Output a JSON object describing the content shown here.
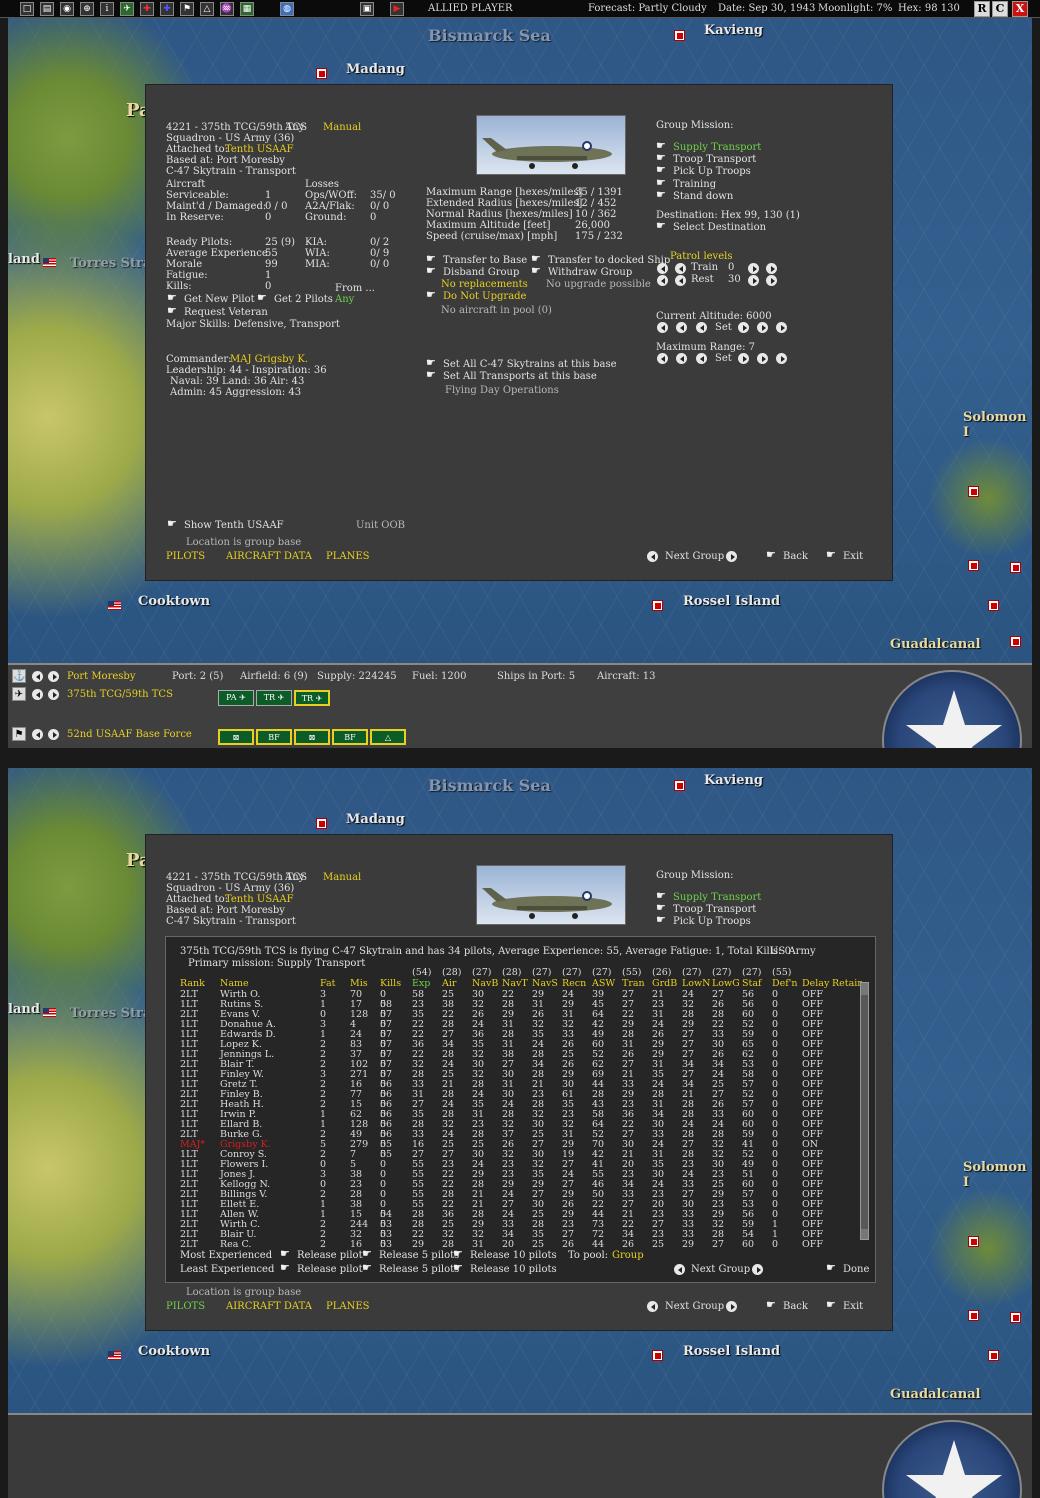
{
  "toolbar": {
    "icons": [
      "□",
      "▤",
      "◉",
      "⊕",
      "i",
      "✈",
      "✚",
      "✚",
      "⚑",
      "△",
      "♒",
      "▦",
      "◍",
      "▣",
      "▶"
    ],
    "player": "ALLIED PLAYER",
    "forecast": "Forecast: Partly Cloudy",
    "date": "Date: Sep 30, 1943",
    "moonlight": "Moonlight: 7%",
    "hex": "Hex: 98 130",
    "btn_r": "R",
    "btn_c": "C",
    "btn_x": "X"
  },
  "map": {
    "bismarck": "Bismarck Sea",
    "kavieng": "Kavieng",
    "madang": "Madang",
    "pa": "Pa",
    "torres": "Torres Stra",
    "land": "land",
    "solomon": "Solomon I",
    "cooktown": "Cooktown",
    "rossel": "Rossel Island",
    "guadalcanal": "Guadalcanal"
  },
  "group": {
    "title": "4221 - 375th TCG/59th TCS",
    "any": "Any",
    "manual": "Manual",
    "squadron": "Squadron - US Army (36)",
    "attached_label": "Attached to:",
    "attached": "Tenth USAAF",
    "based": "Based at: Port Moresby",
    "aircraft_type": "C-47 Skytrain - Transport",
    "aircraft_hdr": "Aircraft",
    "losses_hdr": "Losses",
    "serviceable_l": "Serviceable:",
    "serviceable_v": "1",
    "maintd_l": "Maint'd / Damaged:",
    "maintd_v": "0 / 0",
    "reserve_l": "In Reserve:",
    "reserve_v": "0",
    "ops_l": "Ops/WOff:",
    "ops_v": "35/ 0",
    "a2a_l": "A2A/Flak:",
    "a2a_v": "0/ 0",
    "ground_l": "Ground:",
    "ground_v": "0",
    "ready_l": "Ready Pilots:",
    "ready_v": "25 (9)",
    "avgexp_l": "Average Experience",
    "avgexp_v": "55",
    "morale_l": "Morale",
    "morale_v": "99",
    "fatigue_l": "Fatigue:",
    "fatigue_v": "1",
    "kills_l": "Kills:",
    "kills_v": "0",
    "kia_l": "KIA:",
    "kia_v": "0/ 2",
    "wia_l": "WIA:",
    "wia_v": "0/ 9",
    "mia_l": "MIA:",
    "mia_v": "0/ 0",
    "from_l": "From ...",
    "from_v": "Any",
    "get_new_pilot": "Get New Pilot",
    "get_2_pilots": "Get 2 Pilots",
    "request_veteran": "Request Veteran",
    "major_skills": "Major Skills: Defensive, Transport",
    "commander_l": "Commander:",
    "commander_v": "MAJ Grigsby K.",
    "leadership": "Leadership: 44 - Inspiration: 36",
    "naval_land_air": "Naval: 39  Land: 36  Air: 43",
    "admin_aggr": "Admin: 45  Aggression: 43",
    "max_range_l": "Maximum Range [hexes/miles]",
    "max_range_v": "35 / 1391",
    "ext_radius_l": "Extended Radius [hexes/miles]",
    "ext_radius_v": "12 / 452",
    "norm_radius_l": "Normal Radius [hexes/miles]",
    "norm_radius_v": "10 / 362",
    "max_alt_l": "Maximum Altitude [feet]",
    "max_alt_v": "26,000",
    "speed_l": "Speed (cruise/max) [mph]",
    "speed_v": "175 / 232",
    "transfer_base": "Transfer to Base",
    "transfer_ship": "Transfer to docked Ship",
    "disband": "Disband Group",
    "withdraw": "Withdraw Group",
    "no_replacements": "No replacements",
    "no_upgrade_possible": "No upgrade possible",
    "do_not_upgrade": "Do Not Upgrade",
    "no_aircraft_pool": "No aircraft in pool (0)",
    "set_all_c47": "Set All C-47 Skytrains at this base",
    "set_all_transports": "Set All Transports at this base",
    "flying_day": "Flying Day Operations",
    "show_tenth": "Show Tenth USAAF",
    "unit_oob": "Unit OOB",
    "location": "Location is group base",
    "tab_pilots": "PILOTS",
    "tab_aircraft": "AIRCRAFT DATA",
    "tab_planes": "PLANES",
    "next_group": "Next Group",
    "back": "Back",
    "exit": "Exit"
  },
  "mission": {
    "header": "Group Mission:",
    "supply": "Supply Transport",
    "troop": "Troop Transport",
    "pickup": "Pick Up Troops",
    "training": "Training",
    "standdown": "Stand down",
    "destination": "Destination: Hex 99, 130 (1)",
    "select_dest": "Select Destination",
    "patrol_levels": "Patrol levels",
    "train_l": "Train",
    "train_v": "0",
    "rest_l": "Rest",
    "rest_v": "30",
    "current_alt": "Current Altitude: 6000",
    "set": "Set",
    "max_range": "Maximum Range: 7"
  },
  "infobar": {
    "port_moresby": "Port Moresby",
    "port": "Port: 2 (5)",
    "airfield": "Airfield: 6 (9)",
    "supply": "Supply: 224245",
    "fuel": "Fuel: 1200",
    "ships": "Ships in Port: 5",
    "aircraft": "Aircraft: 13",
    "group_name": "375th TCG/59th TCS",
    "base_force": "52nd USAAF Base Force",
    "slots_air": [
      "PA",
      "TR",
      "TR"
    ],
    "slots_units": [
      "⊠",
      "BF",
      "⊠",
      "BF",
      "△"
    ]
  },
  "roster": {
    "summary": "375th TCG/59th TCS is flying C-47 Skytrain and has 34 pilots,  Average Experience: 55, Average Fatigue: 1, Total Kills: 0",
    "army": "US Army",
    "primary": "Primary mission: Supply Transport",
    "avg_row": [
      "(54)",
      "(28)",
      "(27)",
      "(28)",
      "(27)",
      "(27)",
      "(27)",
      "(55)",
      "(26)",
      "(27)",
      "(27)",
      "(27)",
      "(55)"
    ],
    "headers": [
      "Rank",
      "Name",
      "Fat",
      "Mis",
      "Kills",
      "Exp",
      "Air",
      "NavB",
      "NavT",
      "NavS",
      "Recn",
      "ASW",
      "Tran",
      "GrdB",
      "LowN",
      "LowG",
      "Staf",
      "Def'n",
      "Delay",
      "Retain"
    ],
    "rows": [
      [
        "2LT",
        "Wirth O.",
        "3",
        "70",
        "0",
        "58",
        "25",
        "30",
        "22",
        "29",
        "24",
        "39",
        "27",
        "21",
        "24",
        "27",
        "56",
        "0",
        "OFF"
      ],
      [
        "1LT",
        "Rutins S.",
        "1",
        "17",
        "0",
        "58",
        "23",
        "38",
        "32",
        "28",
        "31",
        "29",
        "45",
        "27",
        "23",
        "32",
        "26",
        "56",
        "0",
        "OFF"
      ],
      [
        "2LT",
        "Evans V.",
        "0",
        "128",
        "0",
        "57",
        "35",
        "22",
        "26",
        "29",
        "26",
        "31",
        "64",
        "22",
        "31",
        "28",
        "28",
        "60",
        "0",
        "OFF"
      ],
      [
        "1LT",
        "Donahue A.",
        "3",
        "4",
        "0",
        "57",
        "22",
        "28",
        "24",
        "31",
        "32",
        "32",
        "42",
        "29",
        "24",
        "29",
        "22",
        "52",
        "0",
        "OFF"
      ],
      [
        "1LT",
        "Edwards D.",
        "1",
        "24",
        "0",
        "57",
        "22",
        "27",
        "36",
        "28",
        "35",
        "33",
        "49",
        "28",
        "26",
        "27",
        "33",
        "59",
        "0",
        "OFF"
      ],
      [
        "1LT",
        "Lopez K.",
        "2",
        "83",
        "0",
        "57",
        "36",
        "34",
        "35",
        "31",
        "24",
        "26",
        "60",
        "31",
        "29",
        "27",
        "30",
        "65",
        "0",
        "OFF"
      ],
      [
        "1LT",
        "Jennings L.",
        "2",
        "37",
        "0",
        "57",
        "22",
        "28",
        "32",
        "38",
        "28",
        "25",
        "52",
        "26",
        "29",
        "27",
        "26",
        "62",
        "0",
        "OFF"
      ],
      [
        "2LT",
        "Blair T.",
        "2",
        "102",
        "0",
        "57",
        "32",
        "24",
        "30",
        "27",
        "34",
        "26",
        "62",
        "27",
        "31",
        "34",
        "34",
        "53",
        "0",
        "OFF"
      ],
      [
        "1LT",
        "Finley W.",
        "3",
        "271",
        "0",
        "57",
        "28",
        "25",
        "32",
        "30",
        "28",
        "29",
        "69",
        "21",
        "35",
        "27",
        "24",
        "58",
        "0",
        "OFF"
      ],
      [
        "1LT",
        "Gretz T.",
        "2",
        "16",
        "0",
        "56",
        "33",
        "21",
        "28",
        "31",
        "21",
        "30",
        "44",
        "33",
        "24",
        "34",
        "25",
        "57",
        "0",
        "OFF"
      ],
      [
        "2LT",
        "Finley B.",
        "2",
        "77",
        "0",
        "56",
        "31",
        "28",
        "24",
        "30",
        "23",
        "61",
        "28",
        "29",
        "28",
        "21",
        "27",
        "52",
        "0",
        "OFF"
      ],
      [
        "2LT",
        "Heath H.",
        "2",
        "15",
        "0",
        "56",
        "27",
        "24",
        "35",
        "24",
        "28",
        "35",
        "43",
        "23",
        "31",
        "28",
        "26",
        "57",
        "0",
        "OFF"
      ],
      [
        "1LT",
        "Irwin P.",
        "1",
        "62",
        "0",
        "56",
        "35",
        "28",
        "31",
        "28",
        "32",
        "23",
        "58",
        "36",
        "34",
        "28",
        "33",
        "60",
        "0",
        "OFF"
      ],
      [
        "1LT",
        "Ellard B.",
        "1",
        "128",
        "0",
        "56",
        "28",
        "32",
        "23",
        "32",
        "30",
        "32",
        "64",
        "22",
        "30",
        "24",
        "24",
        "60",
        "0",
        "OFF"
      ],
      [
        "2LT",
        "Burke G.",
        "2",
        "49",
        "0",
        "56",
        "33",
        "24",
        "28",
        "37",
        "25",
        "31",
        "52",
        "27",
        "33",
        "28",
        "28",
        "59",
        "0",
        "OFF"
      ],
      [
        "MAJ*",
        "Grigsby K.",
        "5",
        "279",
        "0",
        "55",
        "16",
        "25",
        "25",
        "26",
        "27",
        "29",
        "70",
        "30",
        "24",
        "27",
        "32",
        "41",
        "0",
        "ON"
      ],
      [
        "1LT",
        "Conroy S.",
        "2",
        "7",
        "0",
        "55",
        "27",
        "27",
        "30",
        "32",
        "30",
        "19",
        "42",
        "21",
        "31",
        "28",
        "32",
        "52",
        "0",
        "OFF"
      ],
      [
        "1LT",
        "Flowers I.",
        "0",
        "5",
        "0",
        "55",
        "23",
        "24",
        "23",
        "32",
        "27",
        "41",
        "20",
        "35",
        "23",
        "30",
        "49",
        "0",
        "OFF"
      ],
      [
        "1LT",
        "Jones J.",
        "3",
        "38",
        "0",
        "55",
        "22",
        "29",
        "23",
        "35",
        "24",
        "55",
        "23",
        "30",
        "24",
        "23",
        "51",
        "0",
        "OFF"
      ],
      [
        "2LT",
        "Kellogg N.",
        "0",
        "23",
        "0",
        "55",
        "22",
        "28",
        "29",
        "29",
        "27",
        "46",
        "34",
        "24",
        "33",
        "25",
        "60",
        "0",
        "OFF"
      ],
      [
        "2LT",
        "Billings V.",
        "2",
        "28",
        "0",
        "55",
        "28",
        "21",
        "24",
        "27",
        "29",
        "50",
        "33",
        "23",
        "27",
        "29",
        "57",
        "0",
        "OFF"
      ],
      [
        "1LT",
        "Ellett E.",
        "1",
        "38",
        "0",
        "55",
        "22",
        "21",
        "27",
        "30",
        "26",
        "22",
        "27",
        "20",
        "30",
        "23",
        "53",
        "0",
        "OFF"
      ],
      [
        "1LT",
        "Allen W.",
        "1",
        "15",
        "0",
        "54",
        "28",
        "36",
        "28",
        "24",
        "25",
        "29",
        "44",
        "21",
        "23",
        "33",
        "29",
        "56",
        "0",
        "OFF"
      ],
      [
        "2LT",
        "Wirth C.",
        "2",
        "244",
        "0",
        "53",
        "28",
        "25",
        "29",
        "33",
        "28",
        "23",
        "73",
        "22",
        "27",
        "33",
        "32",
        "59",
        "1",
        "OFF"
      ],
      [
        "2LT",
        "Blair U.",
        "2",
        "32",
        "0",
        "53",
        "22",
        "32",
        "32",
        "34",
        "35",
        "27",
        "72",
        "34",
        "23",
        "33",
        "28",
        "54",
        "1",
        "OFF"
      ],
      [
        "2LT",
        "Rea C.",
        "2",
        "16",
        "0",
        "53",
        "29",
        "28",
        "31",
        "20",
        "25",
        "26",
        "44",
        "26",
        "25",
        "29",
        "27",
        "60",
        "0",
        "OFF"
      ]
    ],
    "most_exp": "Most Experienced",
    "least_exp": "Least Experienced",
    "release_pilot": "Release pilot",
    "release_5": "Release 5 pilots",
    "release_10": "Release 10 pilots",
    "to_pool_l": "To pool:",
    "to_pool_v": "Group",
    "next_group": "Next Group",
    "done": "Done"
  },
  "colors": {
    "dialog_bg": "#3b3b3b",
    "yellow": "#e8d020",
    "green": "#6ed24a",
    "highlight_row": "#d02020"
  }
}
